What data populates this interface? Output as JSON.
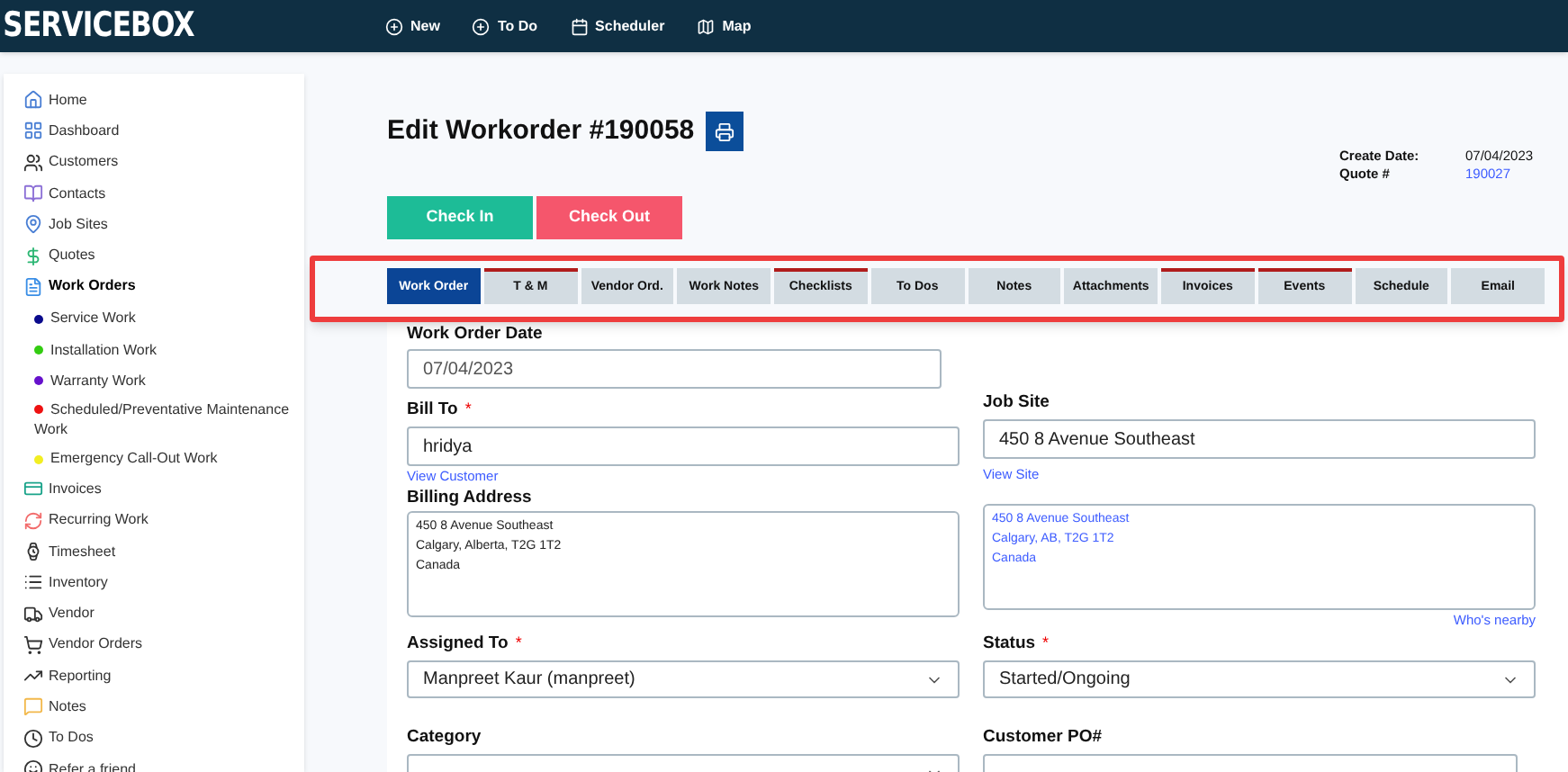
{
  "header": {
    "logo": "SERVICEBOX",
    "actions": [
      {
        "kind": "new",
        "label": "New"
      },
      {
        "kind": "todo",
        "label": "To Do"
      },
      {
        "kind": "scheduler",
        "label": "Scheduler"
      },
      {
        "kind": "map",
        "label": "Map"
      }
    ]
  },
  "sidebar": {
    "items": [
      {
        "kind": "home",
        "label": "Home",
        "selected": false
      },
      {
        "kind": "dashboard",
        "label": "Dashboard",
        "selected": false
      },
      {
        "kind": "customers",
        "label": "Customers",
        "selected": false
      },
      {
        "kind": "contacts",
        "label": "Contacts",
        "selected": false
      },
      {
        "kind": "jobsites",
        "label": "Job Sites",
        "selected": false
      },
      {
        "kind": "quotes",
        "label": "Quotes",
        "selected": false
      },
      {
        "kind": "workorders",
        "label": "Work Orders",
        "selected": true,
        "children": [
          {
            "label": "Service Work",
            "color": "#0a0a8c"
          },
          {
            "label": "Installation Work",
            "color": "#33cc11"
          },
          {
            "label": "Warranty Work",
            "color": "#6611cc"
          },
          {
            "label": "Scheduled/Preventative Maintenance Work",
            "color": "#ee1111"
          },
          {
            "label": "Emergency Call-Out Work",
            "color": "#f2ee22"
          }
        ]
      },
      {
        "kind": "invoices",
        "label": "Invoices",
        "selected": false
      },
      {
        "kind": "recurring",
        "label": "Recurring Work",
        "selected": false
      },
      {
        "kind": "timesheet",
        "label": "Timesheet",
        "selected": false
      },
      {
        "kind": "inventory",
        "label": "Inventory",
        "selected": false
      },
      {
        "kind": "vendor",
        "label": "Vendor",
        "selected": false
      },
      {
        "kind": "vendororders",
        "label": "Vendor Orders",
        "selected": false
      },
      {
        "kind": "reporting",
        "label": "Reporting",
        "selected": false
      },
      {
        "kind": "notes",
        "label": "Notes",
        "selected": false
      },
      {
        "kind": "todos",
        "label": "To Dos",
        "selected": false
      },
      {
        "kind": "refer",
        "label": "Refer a friend",
        "selected": false
      }
    ]
  },
  "page": {
    "title": "Edit Workorder #190058",
    "meta": [
      {
        "label": "Create Date:",
        "value": "07/04/2023",
        "kind": "text"
      },
      {
        "label": "Quote #",
        "value": "190027",
        "kind": "link"
      }
    ],
    "buttons": [
      {
        "kind": "checkin",
        "label": "Check In"
      },
      {
        "kind": "checkout",
        "label": "Check Out"
      }
    ],
    "tabs": [
      {
        "label": "Work Order",
        "selected": true,
        "flagged": false
      },
      {
        "label": "T & M",
        "selected": false,
        "flagged": true
      },
      {
        "label": "Vendor Ord.",
        "selected": false,
        "flagged": false
      },
      {
        "label": "Work Notes",
        "selected": false,
        "flagged": false
      },
      {
        "label": "Checklists",
        "selected": false,
        "flagged": true
      },
      {
        "label": "To Dos",
        "selected": false,
        "flagged": false
      },
      {
        "label": "Notes",
        "selected": false,
        "flagged": false
      },
      {
        "label": "Attachments",
        "selected": false,
        "flagged": false
      },
      {
        "label": "Invoices",
        "selected": false,
        "flagged": true
      },
      {
        "label": "Events",
        "selected": false,
        "flagged": true
      },
      {
        "label": "Schedule",
        "selected": false,
        "flagged": false
      },
      {
        "label": "Email",
        "selected": false,
        "flagged": false
      }
    ]
  },
  "form": {
    "work_order_date": {
      "label": "Work Order Date",
      "value": "07/04/2023"
    },
    "bill_to": {
      "label": "Bill To",
      "required_mark": "*",
      "value": "hridya",
      "link": "View Customer"
    },
    "job_site": {
      "label": "Job Site",
      "value": "450 8 Avenue Southeast",
      "link": "View Site"
    },
    "billing_address": {
      "label": "Billing Address",
      "lines": [
        "450 8 Avenue Southeast",
        "Calgary, Alberta, T2G 1T2",
        "Canada"
      ]
    },
    "site_address": {
      "lines": [
        "450 8 Avenue Southeast",
        "Calgary, AB, T2G 1T2",
        "Canada"
      ],
      "link": "Who's nearby"
    },
    "assigned_to": {
      "label": "Assigned To",
      "required_mark": "*",
      "value": "Manpreet Kaur (manpreet)"
    },
    "status": {
      "label": "Status",
      "required_mark": "*",
      "value": "Started/Ongoing"
    },
    "category": {
      "label": "Category"
    },
    "customer_po": {
      "label": "Customer PO#"
    }
  }
}
